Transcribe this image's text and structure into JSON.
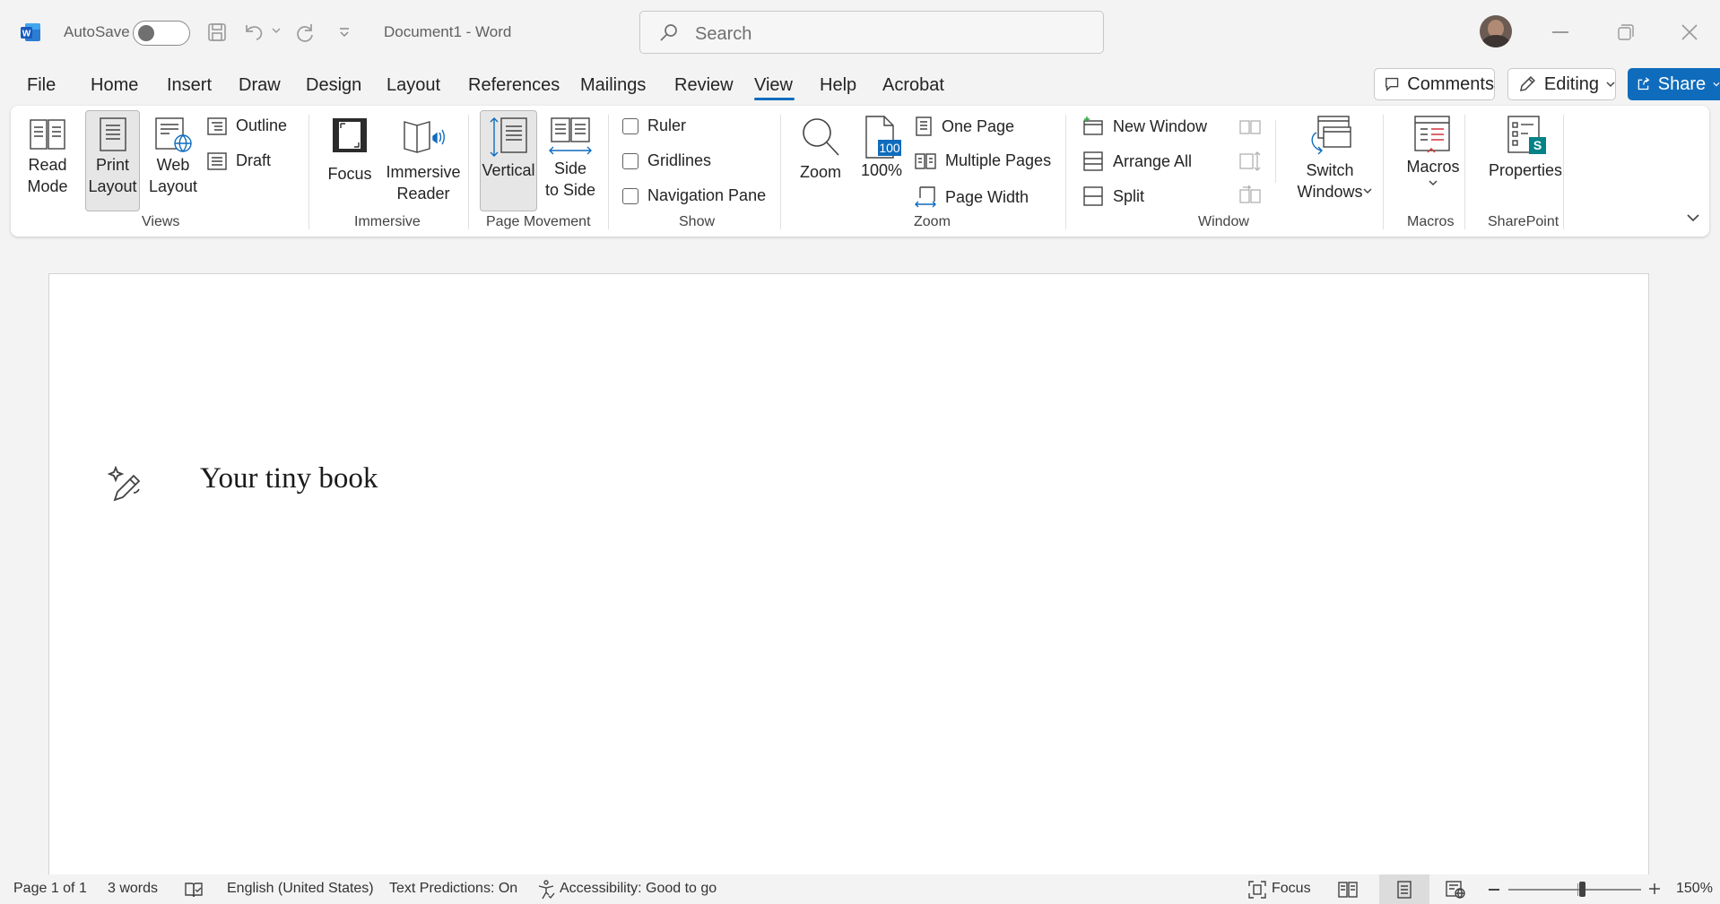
{
  "titlebar": {
    "autosave_label": "AutoSave",
    "document_title": "Document1  -  Word",
    "search_placeholder": "Search"
  },
  "menu": {
    "tabs": [
      "File",
      "Home",
      "Insert",
      "Draw",
      "Design",
      "Layout",
      "References",
      "Mailings",
      "Review",
      "View",
      "Help",
      "Acrobat"
    ],
    "active": "View",
    "comments_label": "Comments",
    "editing_label": "Editing",
    "share_label": "Share"
  },
  "ribbon": {
    "views": {
      "read_mode": "Read\nMode",
      "print_layout": "Print\nLayout",
      "web_layout": "Web\nLayout",
      "outline": "Outline",
      "draft": "Draft",
      "group": "Views"
    },
    "immersive": {
      "focus": "Focus",
      "immersive_reader": "Immersive\nReader",
      "group": "Immersive"
    },
    "page_movement": {
      "vertical": "Vertical",
      "side_to_side": "Side\nto Side",
      "group": "Page Movement"
    },
    "show": {
      "ruler": "Ruler",
      "gridlines": "Gridlines",
      "navigation_pane": "Navigation Pane",
      "group": "Show"
    },
    "zoom": {
      "zoom": "Zoom",
      "hundred": "100%",
      "badge": "100",
      "one_page": "One Page",
      "multiple_pages": "Multiple Pages",
      "page_width": "Page Width",
      "group": "Zoom"
    },
    "window": {
      "new_window": "New Window",
      "arrange_all": "Arrange All",
      "split": "Split",
      "switch_windows": "Switch\nWindows",
      "group": "Window"
    },
    "macros": {
      "macros": "Macros",
      "group": "Macros"
    },
    "sharepoint": {
      "properties": "Properties",
      "group": "SharePoint",
      "badge": "S"
    }
  },
  "document": {
    "text": "Your tiny book"
  },
  "statusbar": {
    "page": "Page 1 of 1",
    "words": "3 words",
    "language": "English (United States)",
    "text_predictions": "Text Predictions: On",
    "accessibility": "Accessibility: Good to go",
    "focus": "Focus",
    "zoom_level": "150%"
  },
  "colors": {
    "accent": "#0f6cbd",
    "word_blue": "#185abd"
  }
}
